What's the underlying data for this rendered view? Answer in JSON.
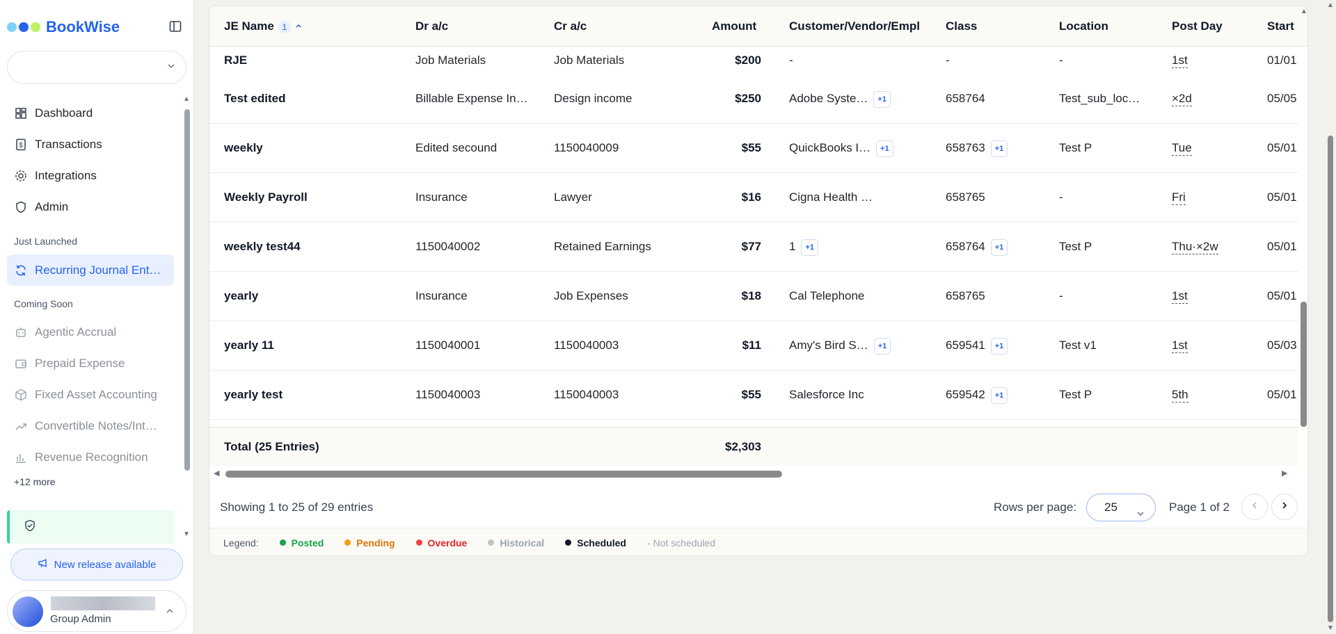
{
  "brand": {
    "name": "BookWise",
    "dot_colors": [
      "#7dd3fc",
      "#2563eb",
      "#bef264"
    ]
  },
  "sidebar": {
    "nav": [
      {
        "label": "Dashboard",
        "icon": "dashboard-icon"
      },
      {
        "label": "Transactions",
        "icon": "dollar-doc-icon"
      },
      {
        "label": "Integrations",
        "icon": "gear-icon"
      },
      {
        "label": "Admin",
        "icon": "shield-icon"
      }
    ],
    "just_launched_heading": "Just Launched",
    "active_item": {
      "label": "Recurring Journal Ent…",
      "icon": "refresh-icon"
    },
    "coming_soon_heading": "Coming Soon",
    "coming_soon": [
      {
        "label": "Agentic Accrual",
        "icon": "robot-icon"
      },
      {
        "label": "Prepaid Expense",
        "icon": "wallet-icon"
      },
      {
        "label": "Fixed Asset Accounting",
        "icon": "box-icon"
      },
      {
        "label": "Convertible Notes/Int…",
        "icon": "trend-icon"
      },
      {
        "label": "Revenue Recognition",
        "icon": "bar-chart-icon"
      }
    ],
    "more_link": "+12 more",
    "release_button": "New release available",
    "user_role": "Group Admin"
  },
  "table": {
    "headers": {
      "je_name": "JE Name",
      "sort_badge": "1",
      "dr": "Dr a/c",
      "cr": "Cr a/c",
      "amount": "Amount",
      "customer": "Customer/Vendor/Empl",
      "class": "Class",
      "location": "Location",
      "post_day": "Post Day",
      "start": "Start"
    },
    "rows": [
      {
        "name": "RJE",
        "dr": "Job Materials",
        "cr": "Job Materials",
        "amount": "$200",
        "customer": "-",
        "customer_chip": "",
        "class": "-",
        "class_chip": "",
        "location": "-",
        "post_day": "1st",
        "start": "01/01"
      },
      {
        "name": "Test edited",
        "dr": "Billable Expense In…",
        "cr": "Design income",
        "amount": "$250",
        "customer": "Adobe Syste…",
        "customer_chip": "+1",
        "class": "658764",
        "class_chip": "",
        "location": "Test_sub_loc…",
        "post_day": "×2d",
        "start": "05/05"
      },
      {
        "name": "weekly",
        "dr": "Edited secound",
        "cr": "1150040009",
        "amount": "$55",
        "customer": "QuickBooks I…",
        "customer_chip": "+1",
        "class": "658763",
        "class_chip": "+1",
        "location": "Test P",
        "post_day": "Tue",
        "start": "05/01"
      },
      {
        "name": "Weekly Payroll",
        "dr": "Insurance",
        "cr": "Lawyer",
        "amount": "$16",
        "customer": "Cigna Health …",
        "customer_chip": "",
        "class": "658765",
        "class_chip": "",
        "location": "-",
        "post_day": "Fri",
        "start": "05/01"
      },
      {
        "name": "weekly test44",
        "dr": "1150040002",
        "cr": "Retained Earnings",
        "amount": "$77",
        "customer": "1",
        "customer_chip": "+1",
        "class": "658764",
        "class_chip": "+1",
        "location": "Test P",
        "post_day": "Thu·×2w",
        "start": "05/01"
      },
      {
        "name": "yearly",
        "dr": "Insurance",
        "cr": "Job Expenses",
        "amount": "$18",
        "customer": "Cal Telephone",
        "customer_chip": "",
        "class": "658765",
        "class_chip": "",
        "location": "-",
        "post_day": "1st",
        "start": "05/01"
      },
      {
        "name": "yearly 11",
        "dr": "1150040001",
        "cr": "1150040003",
        "amount": "$11",
        "customer": "Amy's Bird S…",
        "customer_chip": "+1",
        "class": "659541",
        "class_chip": "+1",
        "location": "Test v1",
        "post_day": "1st",
        "start": "05/03"
      },
      {
        "name": "yearly test",
        "dr": "1150040003",
        "cr": "1150040003",
        "amount": "$55",
        "customer": "Salesforce Inc",
        "customer_chip": "",
        "class": "659542",
        "class_chip": "+1",
        "location": "Test P",
        "post_day": "5th",
        "start": "05/01"
      }
    ],
    "total_label": "Total (25 Entries)",
    "total_amount": "$2,303"
  },
  "footer": {
    "showing": "Showing 1 to 25 of 29 entries",
    "rows_per_page_label": "Rows per page:",
    "rows_per_page_value": "25",
    "page_info": "Page 1 of 2"
  },
  "legend": {
    "title": "Legend:",
    "items": [
      {
        "label": "Posted",
        "color": "#16a34a",
        "dot": true
      },
      {
        "label": "Pending",
        "color": "#d97706",
        "dot": true,
        "dot_color": "#f59e0b"
      },
      {
        "label": "Overdue",
        "color": "#dc2626",
        "dot": true,
        "dot_color": "#ef4444"
      },
      {
        "label": "Historical",
        "color": "#9ca3af",
        "dot": true,
        "dot_color": "#c4c4c4"
      },
      {
        "label": "Scheduled",
        "color": "#111827",
        "dot": true
      },
      {
        "label": "- Not scheduled",
        "color": "#9ca3af",
        "dot": false
      }
    ]
  }
}
